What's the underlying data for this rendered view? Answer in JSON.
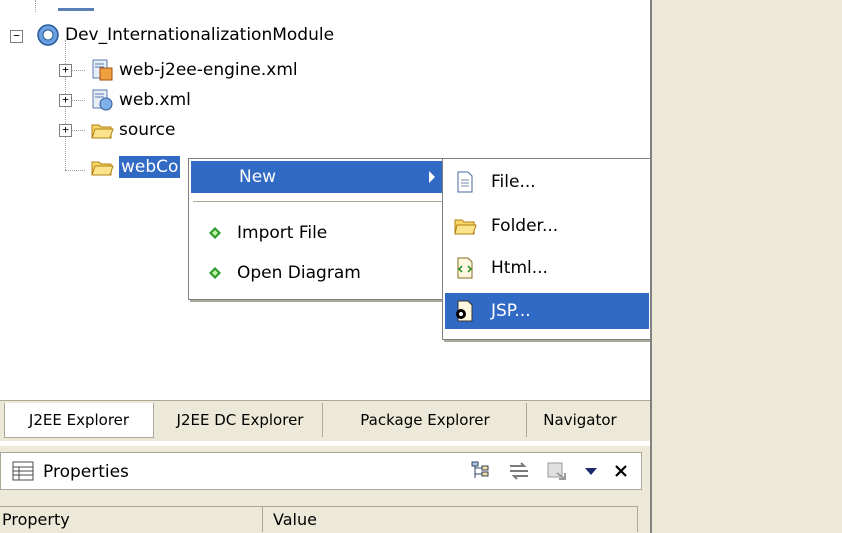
{
  "tree": {
    "items": [
      {
        "label": "Dev_InternationalizationModule"
      },
      {
        "label": "web-j2ee-engine.xml"
      },
      {
        "label": "web.xml"
      },
      {
        "label": "source"
      },
      {
        "label": "webCo"
      }
    ]
  },
  "context_menu": {
    "items": [
      {
        "label": "New"
      },
      {
        "label": "Import File"
      },
      {
        "label": "Open Diagram"
      }
    ]
  },
  "new_submenu": {
    "items": [
      {
        "label": "File..."
      },
      {
        "label": "Folder..."
      },
      {
        "label": "Html..."
      },
      {
        "label": "JSP..."
      }
    ]
  },
  "tabs": [
    {
      "label": "J2EE Explorer"
    },
    {
      "label": "J2EE DC Explorer"
    },
    {
      "label": "Package Explorer"
    },
    {
      "label": "Navigator"
    }
  ],
  "properties": {
    "title": "Properties",
    "columns": [
      "Property",
      "Value"
    ]
  },
  "icons": [
    "module-icon",
    "xml-config-icon",
    "xml-file-icon",
    "folder-open-icon",
    "file-icon",
    "folder-icon",
    "html-icon",
    "jsp-icon",
    "green-diamond-icon",
    "properties-icon",
    "tree-view-icon",
    "filter-icon",
    "restore-icon",
    "view-menu-icon",
    "close-icon"
  ],
  "colors": {
    "selection": "#316ac5",
    "panel_bg": "#ece9d8",
    "tree_bg": "#ffffff"
  }
}
